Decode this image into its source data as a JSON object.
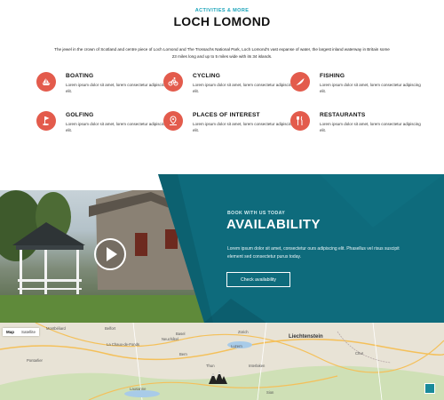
{
  "header": {
    "eyebrow": "ACTIVITIES & MORE",
    "title": "LOCH LOMOND",
    "intro": "The jewel in the crown of Scotland and centre piece of Loch Lomond and The Trossachs National Park, Loch Lomond's vast expanse of water, the largest inland waterway in Britain some 23 miles long and up to 5 miles wide with its 34 islands."
  },
  "activities": [
    {
      "title": "BOATING",
      "desc": "Lorem ipsum dolor sit amet, lorem consectetur adipiscing elit.",
      "icon": "boat-icon"
    },
    {
      "title": "CYCLING",
      "desc": "Lorem ipsum dolor sit amet, lorem consectetur adipiscing elit.",
      "icon": "bicycle-icon"
    },
    {
      "title": "FISHING",
      "desc": "Lorem ipsum dolor sit amet, lorem consectetur adipiscing elit.",
      "icon": "fish-icon"
    },
    {
      "title": "GOLFING",
      "desc": "Lorem ipsum dolor sit amet, lorem consectetur adipiscing elit.",
      "icon": "golf-icon"
    },
    {
      "title": "PLACES OF INTEREST",
      "desc": "Lorem ipsum dolor sit amet, lorem consectetur adipiscing elit.",
      "icon": "map-pin-icon"
    },
    {
      "title": "RESTAURANTS",
      "desc": "Lorem ipsum dolor sit amet, lorem consectetur adipiscing elit.",
      "icon": "cutlery-icon"
    }
  ],
  "booking": {
    "eyebrow": "BOOK WITH US TODAY",
    "title": "AVAILABILITY",
    "text": "Lorem ipsum dolor sit amet, consectetur ours adipiscing elit. Phasellus vel risus suscipit element sed consectetur purus today.",
    "button": "Check availability"
  },
  "map": {
    "tabs": [
      "Map",
      "Satellite"
    ],
    "labels": {
      "liechtenstein": "Liechtenstein",
      "bern": "Bern",
      "luzern": "Luzern",
      "chur": "Chur",
      "montbeliard": "Montbéliard",
      "belfort": "Belfort",
      "basel": "Basel",
      "zurich": "Zürich",
      "lausanne": "Lausanne",
      "interlaken": "Interlaken",
      "chaux": "La Chaux-de-Fonds",
      "pontarlier": "Pontarlier",
      "neuchatel": "Neuchâtel",
      "thun": "Thun",
      "sion": "Sion"
    }
  },
  "colors": {
    "accent_red": "#e35b4c",
    "teal": "#0e6b7c",
    "eyebrow_teal": "#17a2b8"
  }
}
